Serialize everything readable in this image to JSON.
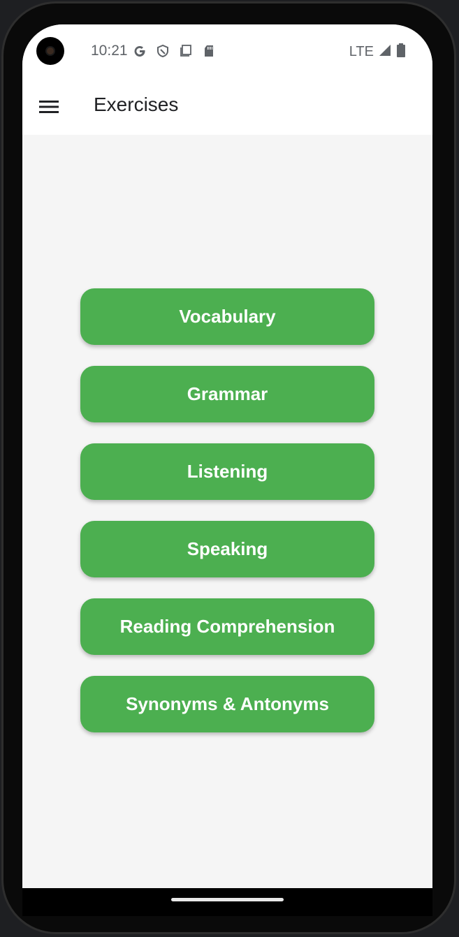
{
  "status_bar": {
    "time": "10:21",
    "network": "LTE",
    "icons": [
      "google-icon",
      "shield-icon",
      "screenshot-icon",
      "sd-card-icon"
    ]
  },
  "app_bar": {
    "title": "Exercises",
    "menu_icon": "hamburger-menu-icon"
  },
  "exercises": [
    {
      "label": "Vocabulary"
    },
    {
      "label": "Grammar"
    },
    {
      "label": "Listening"
    },
    {
      "label": "Speaking"
    },
    {
      "label": "Reading Comprehension"
    },
    {
      "label": "Synonyms & Antonyms"
    }
  ],
  "colors": {
    "accent": "#4caf50",
    "background": "#f5f5f5",
    "app_bar": "#ffffff"
  }
}
